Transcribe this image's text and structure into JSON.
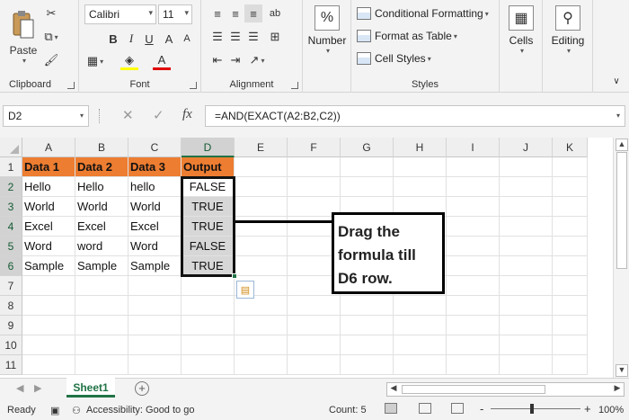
{
  "ribbon": {
    "clipboard": {
      "label": "Clipboard",
      "paste_label": "Paste"
    },
    "font": {
      "label": "Font",
      "font_name": "Calibri",
      "font_size": "11",
      "bold": "B",
      "italic": "I",
      "underline": "U",
      "grow": "A",
      "shrink": "A"
    },
    "alignment": {
      "label": "Alignment",
      "wrap_text": "ab"
    },
    "number": {
      "label": "Number",
      "symbol": "%"
    },
    "styles": {
      "label": "Styles",
      "conditional_formatting": "Conditional Formatting",
      "format_as_table": "Format as Table",
      "cell_styles": "Cell Styles"
    },
    "cells": {
      "label": "Cells"
    },
    "editing": {
      "label": "Editing"
    }
  },
  "formula_bar": {
    "name_box": "D2",
    "fx": "fx",
    "formula": "=AND(EXACT(A2:B2,C2))"
  },
  "grid": {
    "columns": [
      "A",
      "B",
      "C",
      "D",
      "E",
      "F",
      "G",
      "H",
      "I",
      "J",
      "K"
    ],
    "rows": [
      "1",
      "2",
      "3",
      "4",
      "5",
      "6",
      "7",
      "8",
      "9",
      "10",
      "11"
    ],
    "header_row": [
      "Data 1",
      "Data 2",
      "Data 3",
      "Output"
    ],
    "data_rows": [
      [
        "Hello",
        "Hello",
        "hello",
        "FALSE"
      ],
      [
        "World",
        "World",
        "World",
        "TRUE"
      ],
      [
        "Excel",
        "Excel",
        "Excel",
        "TRUE"
      ],
      [
        "Word",
        "word",
        "Word",
        "FALSE"
      ],
      [
        "Sample",
        "Sample",
        "Sample",
        "TRUE"
      ]
    ],
    "selected_column": "D",
    "header_color": "#ed7d31"
  },
  "callout": {
    "line1": "Drag the",
    "line2": "formula till",
    "line3": "D6 row."
  },
  "sheet_tabs": {
    "active": "Sheet1",
    "add_label": "+"
  },
  "status_bar": {
    "ready": "Ready",
    "accessibility": "Accessibility: Good to go",
    "count": "Count: 5",
    "zoom": "100%",
    "zoom_minus": "-",
    "zoom_plus": "+"
  },
  "colors": {
    "accent": "#217346"
  }
}
